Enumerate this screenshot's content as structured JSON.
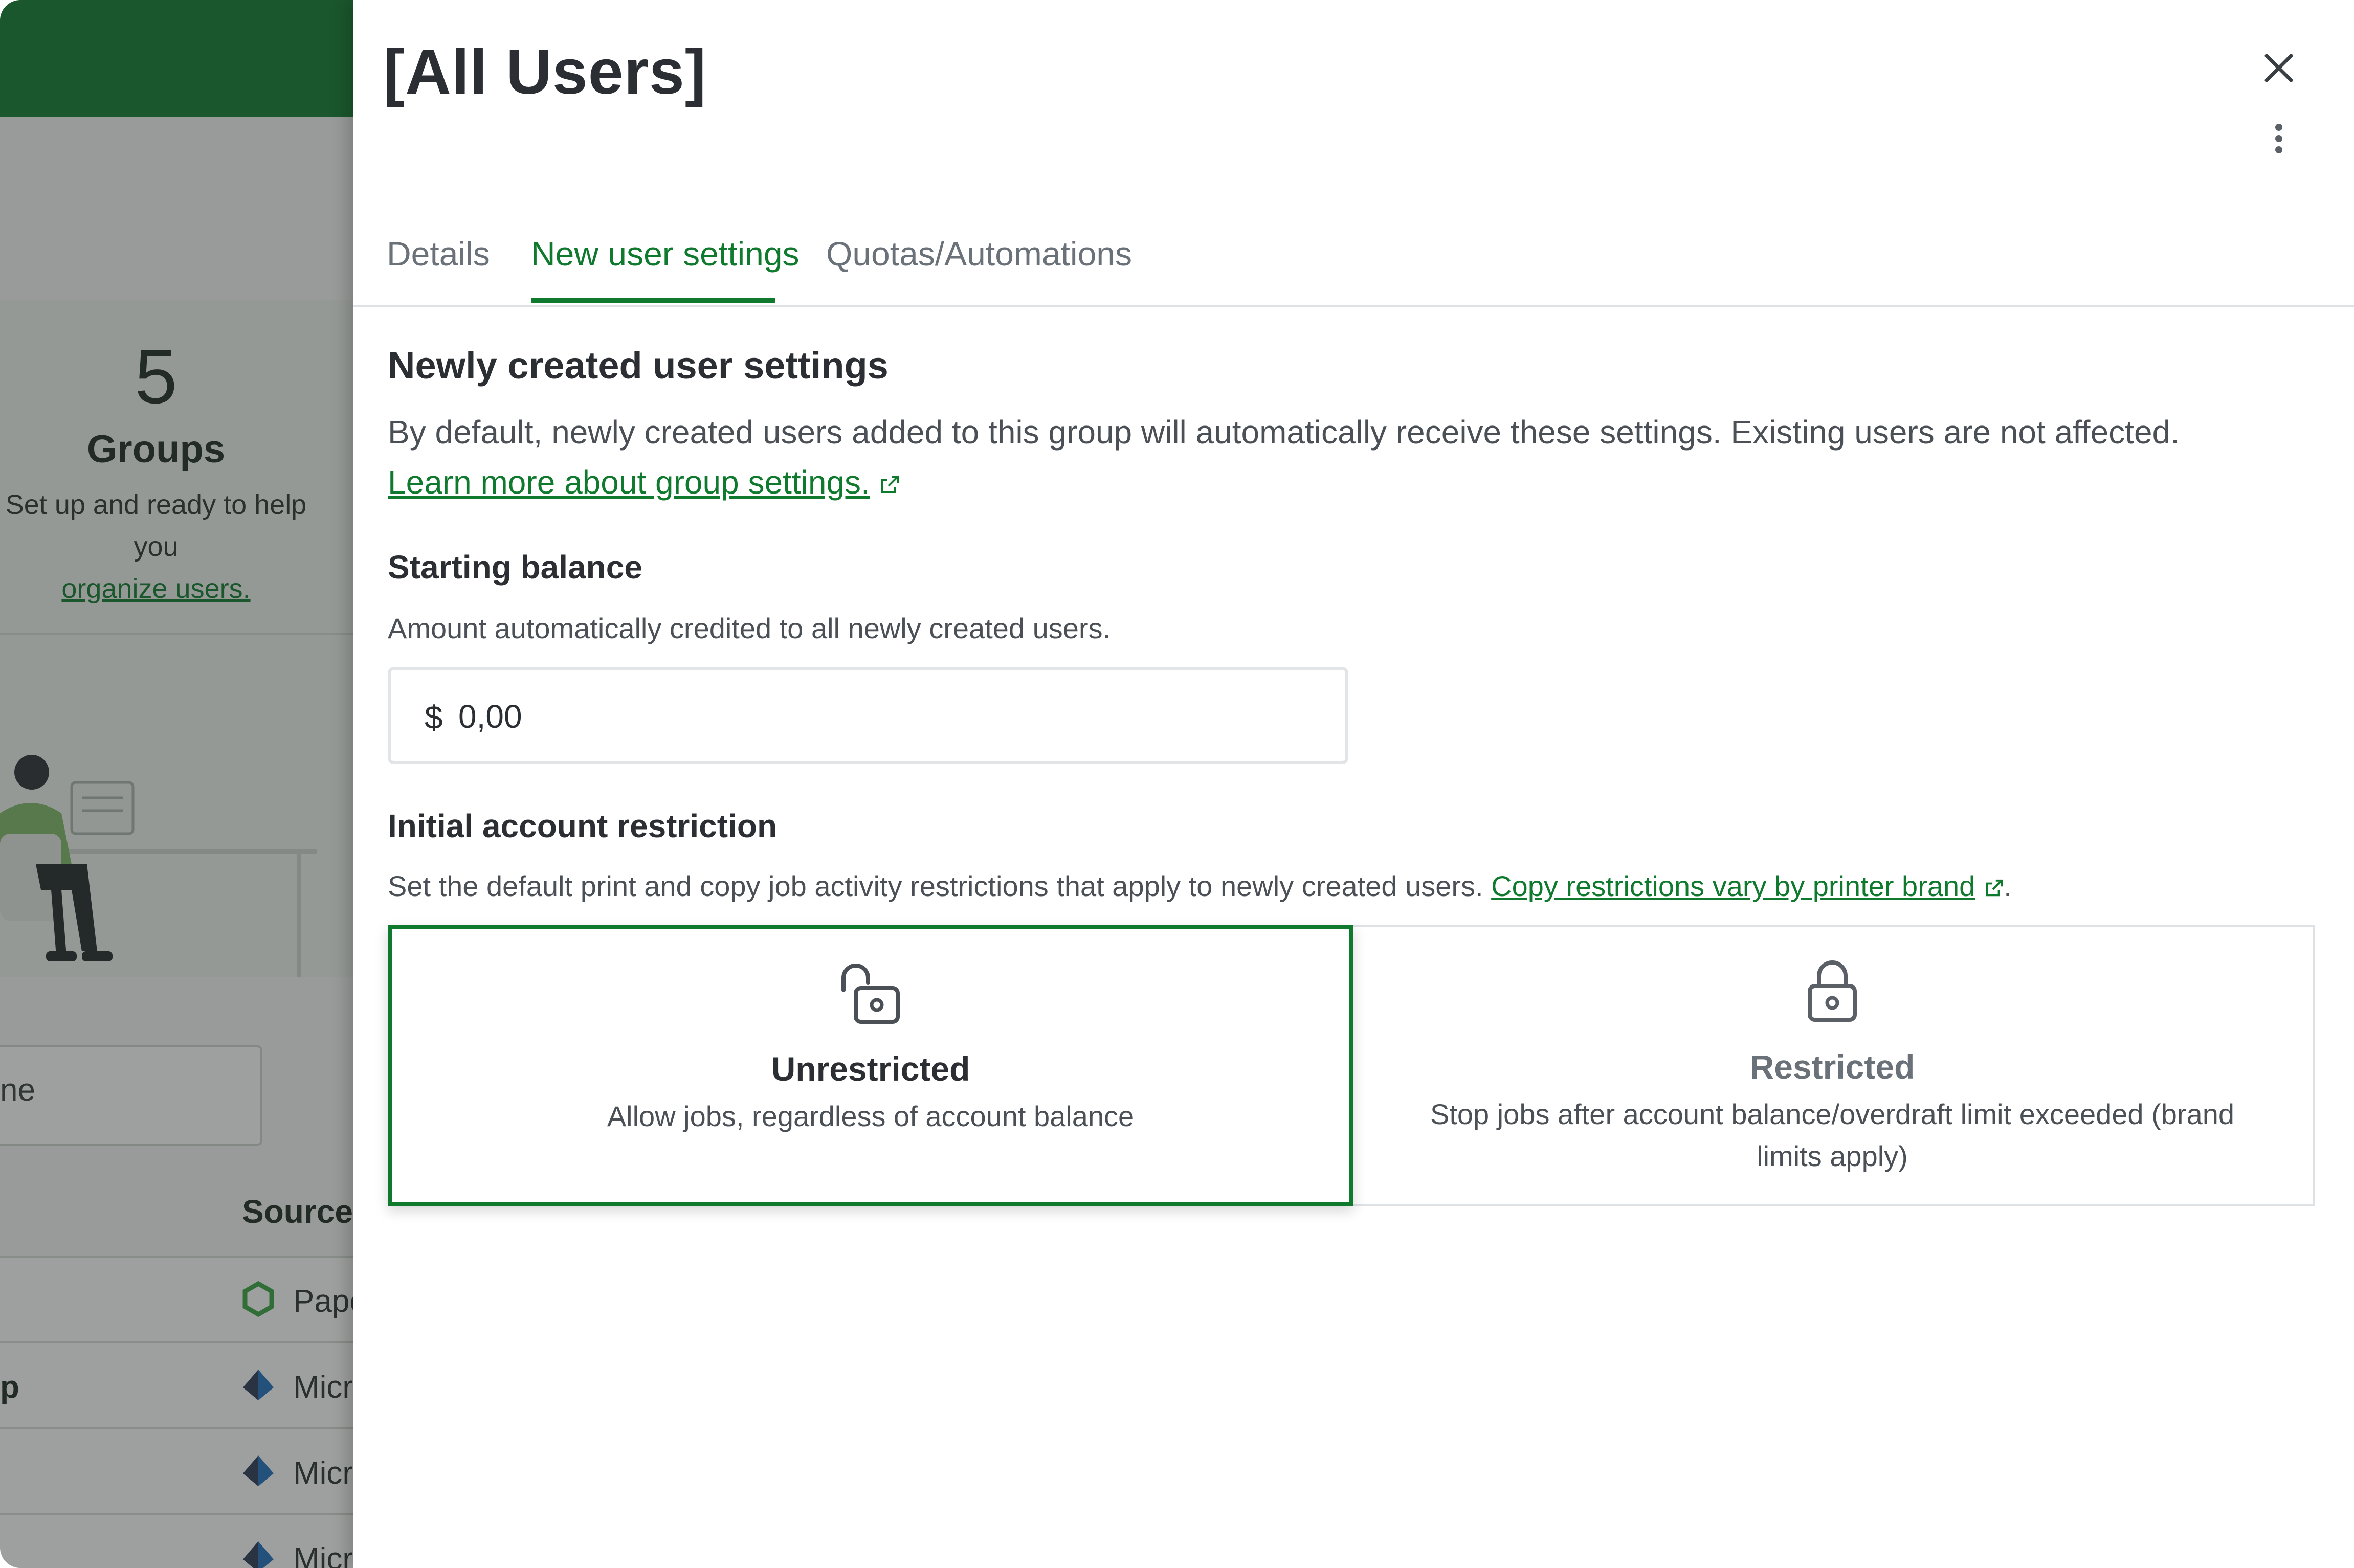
{
  "background": {
    "group_count": "5",
    "groups_label": "Groups",
    "subtitle_text": "Set up and ready to help you",
    "subtitle_link": "organize users.",
    "search_fragment": "ne",
    "table": {
      "source_header": "Source",
      "rows": [
        {
          "lead": "",
          "source": "Pape",
          "icon": "papercut-logo-icon"
        },
        {
          "lead": "p",
          "source": "Micr",
          "icon": "microsoft-azure-icon"
        },
        {
          "lead": "",
          "source": "Micr",
          "icon": "microsoft-azure-icon"
        },
        {
          "lead": "",
          "source": "Micr",
          "icon": "microsoft-azure-icon"
        }
      ]
    }
  },
  "panel": {
    "title": "[All Users]",
    "tabs": [
      {
        "label": "Details",
        "active": false
      },
      {
        "label": "New user settings",
        "active": true
      },
      {
        "label": "Quotas/Automations",
        "active": false
      }
    ],
    "section_title": "Newly created user settings",
    "section_description": "By default, newly created users added to this group will automatically receive these settings. Existing users are not affected.",
    "learn_more_link": "Learn more about group settings.",
    "starting_balance": {
      "title": "Starting balance",
      "hint": "Amount automatically credited to all newly created users.",
      "currency_symbol": "$",
      "value": "0,00"
    },
    "restriction": {
      "title": "Initial account restriction",
      "hint": "Set the default print and copy job activity restrictions that apply to newly created users.",
      "hint_link": "Copy restrictions vary by printer brand",
      "hint_suffix": ".",
      "options": [
        {
          "title": "Unrestricted",
          "description": "Allow jobs, regardless of account balance",
          "selected": true,
          "icon": "unlocked-padlock-icon"
        },
        {
          "title": "Restricted",
          "description": "Stop jobs after account balance/overdraft limit exceeded (brand limits apply)",
          "selected": false,
          "icon": "locked-padlock-icon"
        }
      ]
    }
  },
  "colors": {
    "accent": "#0f7a2e",
    "text_primary": "#2b2f33",
    "text_secondary": "#4a5056",
    "border": "#dfe2e5",
    "overlay": "rgba(40,44,42,0.45)"
  }
}
